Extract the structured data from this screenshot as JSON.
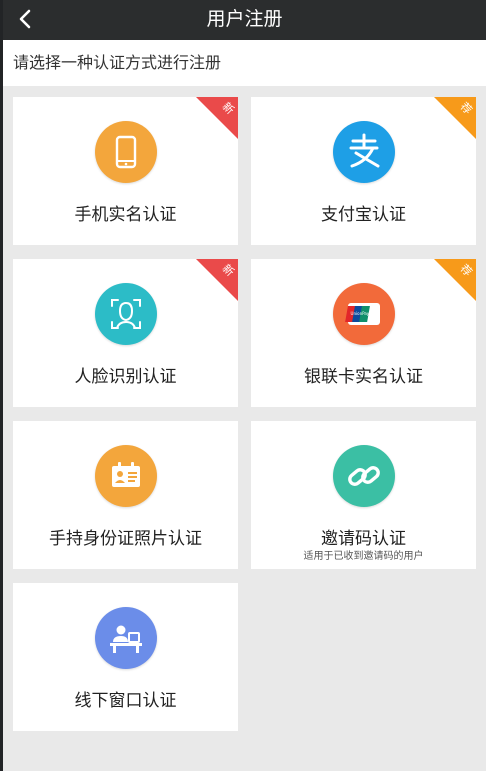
{
  "header": {
    "title": "用户注册",
    "back_icon": "chevron-left-icon"
  },
  "subheader": {
    "text": "请选择一种认证方式进行注册"
  },
  "colors": {
    "orange": "#f3a63c",
    "blue": "#1e9fe6",
    "teal": "#2cbcc7",
    "red_orange": "#f26a3a",
    "green": "#3bbfa4",
    "periwinkle": "#6b8de9",
    "badge_new": "#ea4a4a",
    "badge_recommend": "#f79a1a"
  },
  "options": [
    {
      "label": "手机实名认证",
      "icon": "phone-icon",
      "badge": "新"
    },
    {
      "label": "支付宝认证",
      "icon": "alipay-icon",
      "badge": "荐"
    },
    {
      "label": "人脸识别认证",
      "icon": "face-scan-icon",
      "badge": "新"
    },
    {
      "label": "银联卡实名认证",
      "icon": "unionpay-card-icon",
      "badge": "荐",
      "card_text": "UnionPay 银联"
    },
    {
      "label": "手持身份证照片认证",
      "icon": "id-card-icon"
    },
    {
      "label": "邀请码认证",
      "icon": "link-icon",
      "sublabel": "适用于已收到邀请码的用户"
    },
    {
      "label": "线下窗口认证",
      "icon": "service-counter-icon"
    }
  ]
}
